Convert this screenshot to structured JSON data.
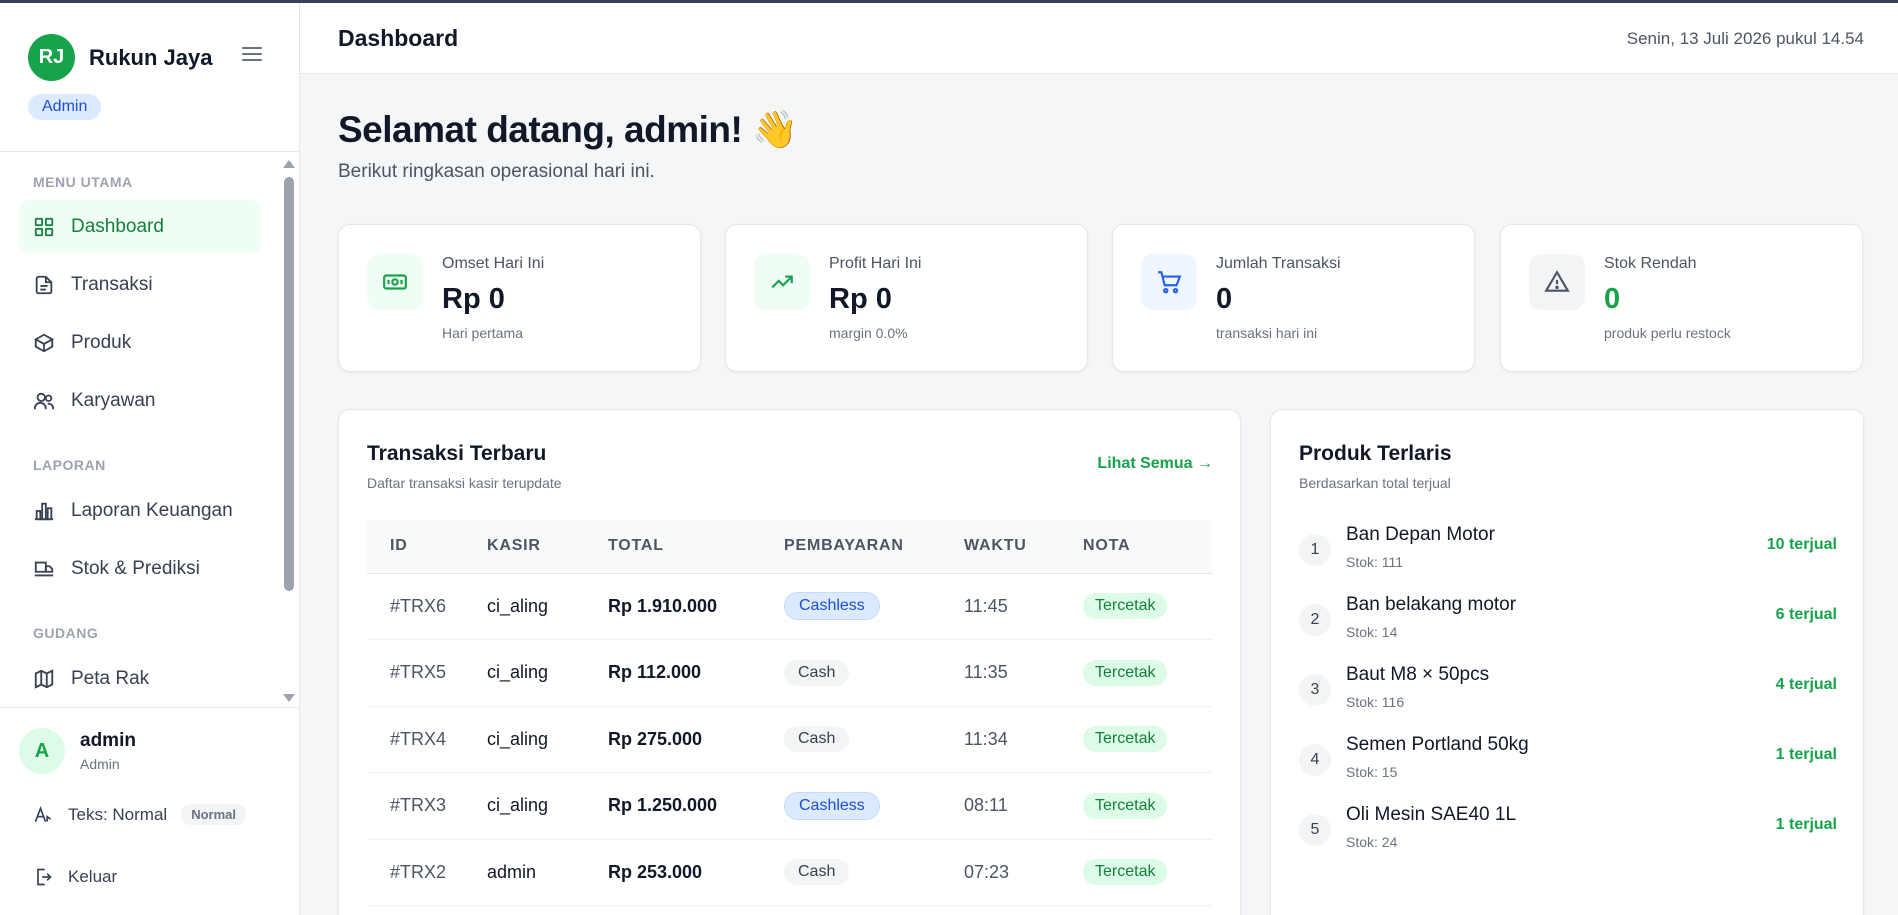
{
  "sidebar": {
    "brand_initials": "RJ",
    "brand_name": "Rukun Jaya",
    "role_badge": "Admin",
    "sections": [
      {
        "label": "MENU UTAMA",
        "items": [
          {
            "label": "Dashboard",
            "icon": "grid-icon",
            "active": true
          },
          {
            "label": "Transaksi",
            "icon": "document-icon"
          },
          {
            "label": "Produk",
            "icon": "box-icon"
          },
          {
            "label": "Karyawan",
            "icon": "users-icon"
          }
        ]
      },
      {
        "label": "LAPORAN",
        "items": [
          {
            "label": "Laporan Keuangan",
            "icon": "bar-chart-icon"
          },
          {
            "label": "Stok & Prediksi",
            "icon": "truck-icon"
          }
        ]
      },
      {
        "label": "GUDANG",
        "items": [
          {
            "label": "Peta Rak",
            "icon": "map-icon"
          }
        ]
      }
    ],
    "user": {
      "initial": "A",
      "name": "admin",
      "role": "Admin"
    },
    "text_size_label": "Teks: Normal",
    "text_size_badge": "Normal",
    "logout_label": "Keluar"
  },
  "header": {
    "title": "Dashboard",
    "datetime": "Senin, 13 Juli 2026 pukul 14.54"
  },
  "welcome": {
    "title": "Selamat datang, admin! 👋",
    "subtitle": "Berikut ringkasan operasional hari ini."
  },
  "stats": [
    {
      "label": "Omset Hari Ini",
      "value": "Rp 0",
      "note": "Hari pertama",
      "icon": "money-icon",
      "icon_bg": "#f0fdf4",
      "icon_color": "#16a34a",
      "value_color": "#111827"
    },
    {
      "label": "Profit Hari Ini",
      "value": "Rp 0",
      "note": "margin 0.0%",
      "icon": "trending-up-icon",
      "icon_bg": "#f0fdf4",
      "icon_color": "#16a34a",
      "value_color": "#111827"
    },
    {
      "label": "Jumlah Transaksi",
      "value": "0",
      "note": "transaksi hari ini",
      "icon": "cart-icon",
      "icon_bg": "#eff6ff",
      "icon_color": "#2563eb",
      "value_color": "#111827"
    },
    {
      "label": "Stok Rendah",
      "value": "0",
      "note": "produk perlu restock",
      "icon": "warning-icon",
      "icon_bg": "#f3f4f6",
      "icon_color": "#4b5563",
      "value_color": "#16a34a"
    }
  ],
  "transactions": {
    "title": "Transaksi Terbaru",
    "subtitle": "Daftar transaksi kasir terupdate",
    "view_all": "Lihat Semua →",
    "columns": [
      "ID",
      "KASIR",
      "TOTAL",
      "PEMBAYARAN",
      "WAKTU",
      "NOTA"
    ],
    "rows": [
      {
        "id": "#TRX6",
        "cashier": "ci_aling",
        "total": "Rp 1.910.000",
        "payment": "Cashless",
        "time": "11:45",
        "status": "Tercetak"
      },
      {
        "id": "#TRX5",
        "cashier": "ci_aling",
        "total": "Rp 112.000",
        "payment": "Cash",
        "time": "11:35",
        "status": "Tercetak"
      },
      {
        "id": "#TRX4",
        "cashier": "ci_aling",
        "total": "Rp 275.000",
        "payment": "Cash",
        "time": "11:34",
        "status": "Tercetak"
      },
      {
        "id": "#TRX3",
        "cashier": "ci_aling",
        "total": "Rp 1.250.000",
        "payment": "Cashless",
        "time": "08:11",
        "status": "Tercetak"
      },
      {
        "id": "#TRX2",
        "cashier": "admin",
        "total": "Rp 253.000",
        "payment": "Cash",
        "time": "07:23",
        "status": "Tercetak"
      }
    ]
  },
  "top_products": {
    "title": "Produk Terlaris",
    "subtitle": "Berdasarkan total terjual",
    "items": [
      {
        "rank": "1",
        "name": "Ban Depan Motor",
        "stock": "Stok: 111",
        "sold": "10 terjual"
      },
      {
        "rank": "2",
        "name": "Ban belakang motor",
        "stock": "Stok: 14",
        "sold": "6 terjual"
      },
      {
        "rank": "3",
        "name": "Baut M8 × 50pcs",
        "stock": "Stok: 116",
        "sold": "4 terjual"
      },
      {
        "rank": "4",
        "name": "Semen Portland 50kg",
        "stock": "Stok: 15",
        "sold": "1 terjual"
      },
      {
        "rank": "5",
        "name": "Oli Mesin SAE40 1L",
        "stock": "Stok: 24",
        "sold": "1 terjual"
      }
    ]
  }
}
